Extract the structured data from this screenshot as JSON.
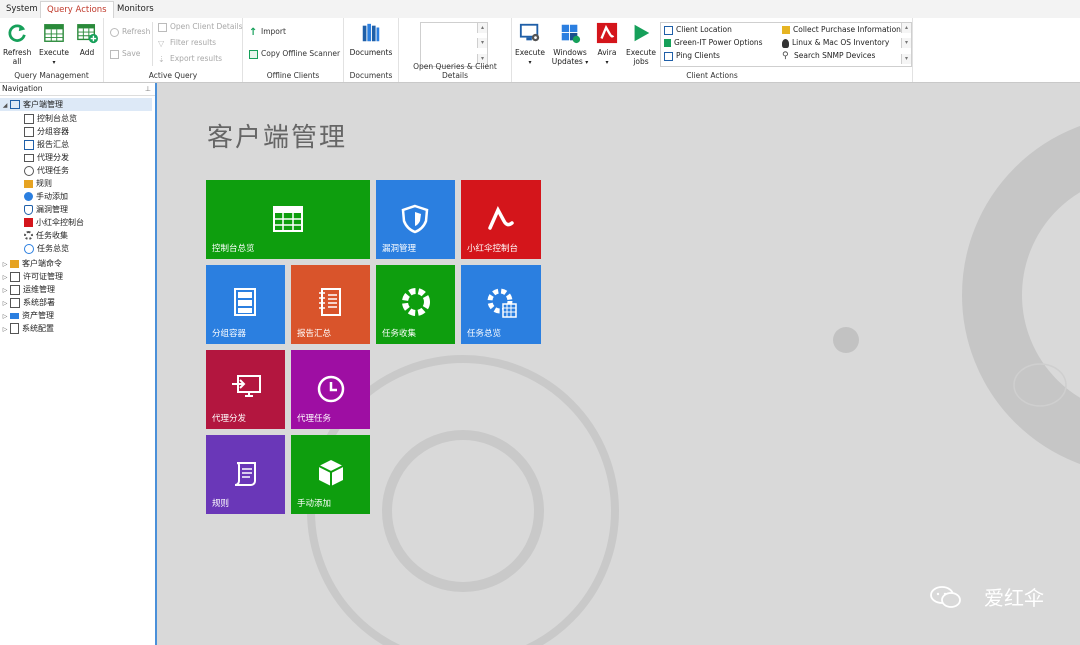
{
  "tabs": [
    "System",
    "Query Actions",
    "Monitors"
  ],
  "ribbon": {
    "query_management": {
      "label": "Query Management",
      "refresh_all": "Refresh all",
      "execute": "Execute",
      "add": "Add"
    },
    "active_query": {
      "label": "Active Query",
      "refresh": "Refresh",
      "save": "Save",
      "open_client_details": "Open Client Details",
      "filter_results": "Filter results",
      "export_results": "Export results"
    },
    "offline_clients": {
      "label": "Offline Clients",
      "import": "Import",
      "copy_offline_scanner": "Copy Offline Scanner"
    },
    "documents": {
      "label": "Documents",
      "documents": "Documents"
    },
    "open_queries": {
      "label": "Open Queries & Client Details"
    },
    "client_actions": {
      "label": "Client Actions",
      "execute": "Execute",
      "windows_updates": "Windows Updates",
      "avira": "Avira",
      "execute_jobs": "Execute jobs",
      "gallery": [
        "Client Location",
        "Collect Purchase Information",
        "Green-IT Power Options",
        "Linux & Mac OS Inventory",
        "Ping Clients",
        "Search SNMP Devices"
      ]
    }
  },
  "navigation": {
    "header": "Navigation",
    "root": "客户端管理",
    "children": [
      "控制台总览",
      "分组容器",
      "报告汇总",
      "代理分发",
      "代理任务",
      "规则",
      "手动添加",
      "漏洞管理",
      "小红伞控制台",
      "任务收集",
      "任务总览"
    ],
    "top_items": [
      "客户端命令",
      "许可证管理",
      "运维管理",
      "系统部署",
      "资产管理",
      "系统配置"
    ]
  },
  "main": {
    "title": "客户端管理",
    "tiles": [
      {
        "label": "控制台总览",
        "color": "#0e9e0e",
        "icon": "grid-icon"
      },
      {
        "label": "漏洞管理",
        "color": "#2b7fe0",
        "icon": "shield-icon"
      },
      {
        "label": "小红伞控制台",
        "color": "#d4151b",
        "icon": "avira-icon"
      },
      {
        "label": "分组容器",
        "color": "#2b7fe0",
        "icon": "cabinet-icon"
      },
      {
        "label": "报告汇总",
        "color": "#d9542b",
        "icon": "notebook-icon"
      },
      {
        "label": "任务收集",
        "color": "#0e9e0e",
        "icon": "ring-icon"
      },
      {
        "label": "任务总览",
        "color": "#2b7fe0",
        "icon": "ring-grid-icon"
      },
      {
        "label": "代理分发",
        "color": "#b3163f",
        "icon": "monitor-arrow-icon"
      },
      {
        "label": "代理任务",
        "color": "#9e0ea3",
        "icon": "clock-icon"
      },
      {
        "label": "规则",
        "color": "#6a37b8",
        "icon": "scroll-icon"
      },
      {
        "label": "手动添加",
        "color": "#0e9e0e",
        "icon": "box-icon"
      }
    ],
    "watermark": "爱红伞"
  }
}
